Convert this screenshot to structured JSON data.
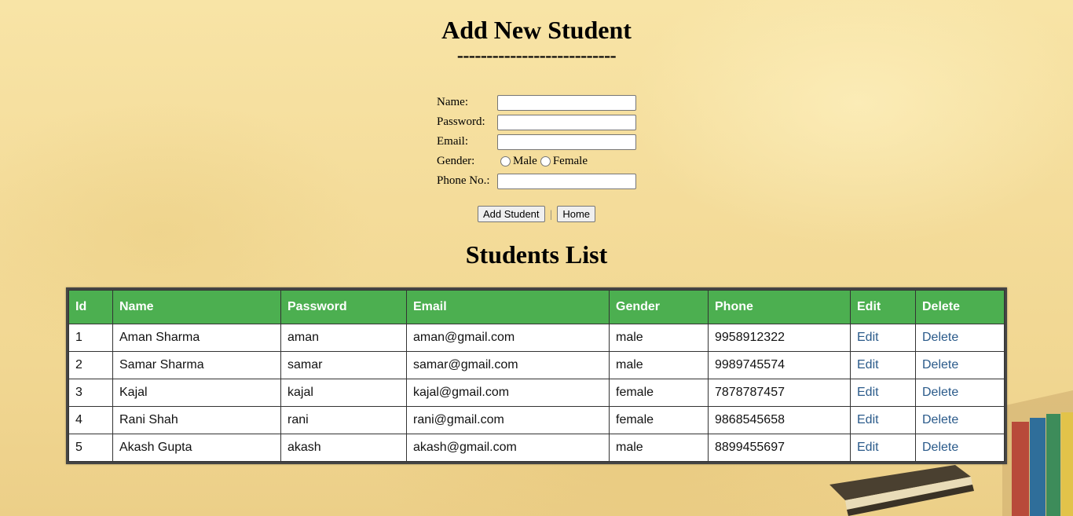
{
  "form": {
    "title": "Add New Student",
    "divider": "---------------------------",
    "name_label": "Name:",
    "name_value": "",
    "password_label": "Password:",
    "password_value": "",
    "email_label": "Email:",
    "email_value": "",
    "gender_label": "Gender:",
    "gender_options": [
      "Male",
      "Female"
    ],
    "phone_label": "Phone No.:",
    "phone_value": "",
    "add_button": "Add Student",
    "separator": "|",
    "home_button": "Home"
  },
  "list": {
    "title": "Students List",
    "columns": [
      "Id",
      "Name",
      "Password",
      "Email",
      "Gender",
      "Phone",
      "Edit",
      "Delete"
    ],
    "rows": [
      {
        "id": "1",
        "name": "Aman Sharma",
        "password": "aman",
        "email": "aman@gmail.com",
        "gender": "male",
        "phone": "9958912322",
        "edit": "Edit",
        "delete": "Delete"
      },
      {
        "id": "2",
        "name": "Samar Sharma",
        "password": "samar",
        "email": "samar@gmail.com",
        "gender": "male",
        "phone": "9989745574",
        "edit": "Edit",
        "delete": "Delete"
      },
      {
        "id": "3",
        "name": "Kajal",
        "password": "kajal",
        "email": "kajal@gmail.com",
        "gender": "female",
        "phone": "7878787457",
        "edit": "Edit",
        "delete": "Delete"
      },
      {
        "id": "4",
        "name": "Rani Shah",
        "password": "rani",
        "email": "rani@gmail.com",
        "gender": "female",
        "phone": "9868545658",
        "edit": "Edit",
        "delete": "Delete"
      },
      {
        "id": "5",
        "name": "Akash Gupta",
        "password": "akash",
        "email": "akash@gmail.com",
        "gender": "male",
        "phone": "8899455697",
        "edit": "Edit",
        "delete": "Delete"
      }
    ]
  },
  "colors": {
    "header_bg": "#4caf50",
    "link": "#2a5a8a",
    "background": "#f4dc9a"
  }
}
